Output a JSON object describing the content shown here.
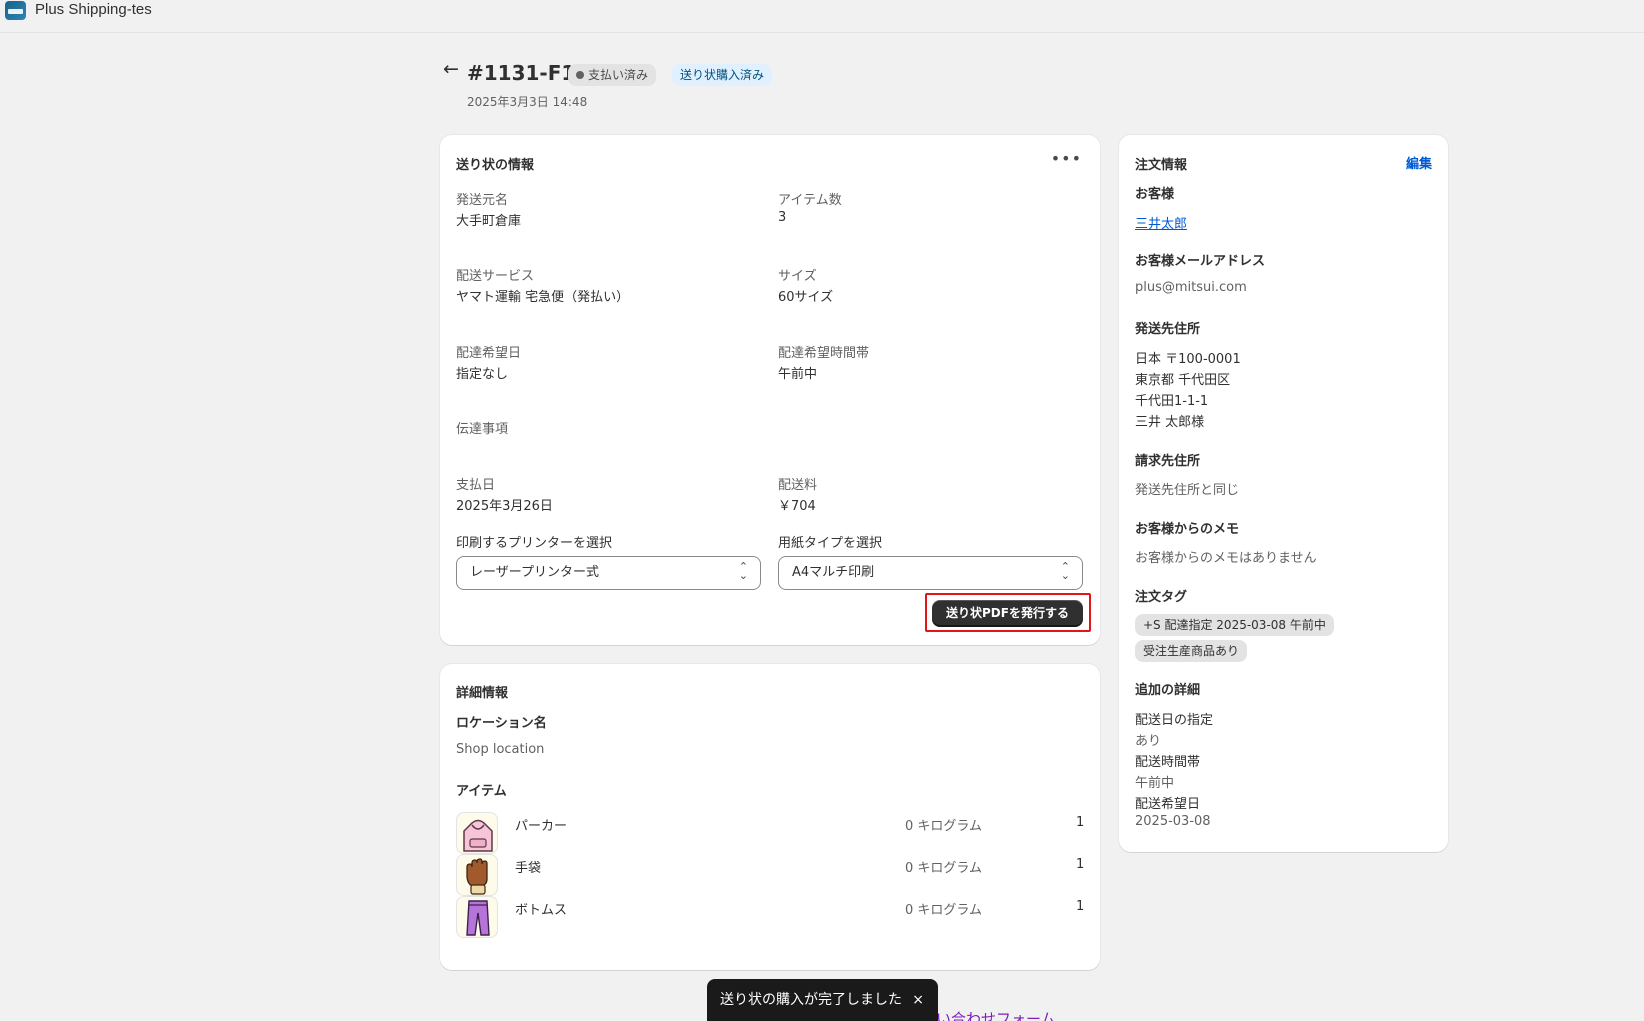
{
  "app": {
    "title": "Plus Shipping-tes"
  },
  "header": {
    "order_id": "#1131-F1",
    "payment_badge": "支払い済み",
    "label_badge": "送り状購入済み",
    "date": "2025年3月3日 14:48"
  },
  "shipping_label": {
    "title": "送り状の情報",
    "sender_label": "発送元名",
    "sender_value": "大手町倉庫",
    "item_count_label": "アイテム数",
    "item_count_value": "3",
    "service_label": "配送サービス",
    "service_value": "ヤマト運輸 宅急便（発払い）",
    "size_label": "サイズ",
    "size_value": "60サイズ",
    "delivery_date_label": "配達希望日",
    "delivery_date_value": "指定なし",
    "delivery_time_label": "配達希望時間帯",
    "delivery_time_value": "午前中",
    "notes_label": "伝達事項",
    "pay_date_label": "支払日",
    "pay_date_value": "2025年3月26日",
    "fee_label": "配送料",
    "fee_value": "￥704",
    "printer_label": "印刷するプリンターを選択",
    "printer_value": "レーザープリンター式",
    "paper_label": "用紙タイプを選択",
    "paper_value": "A4マルチ印刷",
    "issue_button": "送り状PDFを発行する"
  },
  "details": {
    "title": "詳細情報",
    "location_label": "ロケーション名",
    "location_value": "Shop location",
    "items_label": "アイテム",
    "items": [
      {
        "name": "パーカー",
        "weight": "0 キログラム",
        "qty": "1",
        "icon": "hoodie-icon"
      },
      {
        "name": "手袋",
        "weight": "0 キログラム",
        "qty": "1",
        "icon": "glove-icon"
      },
      {
        "name": "ボトムス",
        "weight": "0 キログラム",
        "qty": "1",
        "icon": "pants-icon"
      }
    ]
  },
  "order_info": {
    "title": "注文情報",
    "edit": "編集",
    "customer_label": "お客様",
    "customer_name": "三井太郎",
    "email_label": "お客様メールアドレス",
    "email_value": "plus@mitsui.com",
    "ship_addr_label": "発送先住所",
    "ship_addr_lines": [
      "日本 〒100-0001",
      "東京都 千代田区",
      "千代田1-1-1",
      "三井 太郎様"
    ],
    "bill_addr_label": "請求先住所",
    "bill_addr_value": "発送先住所と同じ",
    "memo_label": "お客様からのメモ",
    "memo_value": "お客様からのメモはありません",
    "tags_label": "注文タグ",
    "tags": [
      "+S 配達指定 2025-03-08 午前中",
      "受注生産商品あり"
    ],
    "extra_label": "追加の詳細",
    "extra_lines": [
      "配送日の指定",
      "あり",
      "配送時間帯",
      "午前中",
      "配送希望日",
      "2025-03-08"
    ]
  },
  "toast": {
    "message": "送り状の購入が完了しました",
    "close": "×"
  },
  "footer": {
    "contact_partial": "い合わせフォーム"
  },
  "colors": {
    "primary_button": "#303030",
    "link": "#005bd3",
    "highlight_border": "#e0161b",
    "badge_blue": "#e0f0ff"
  }
}
